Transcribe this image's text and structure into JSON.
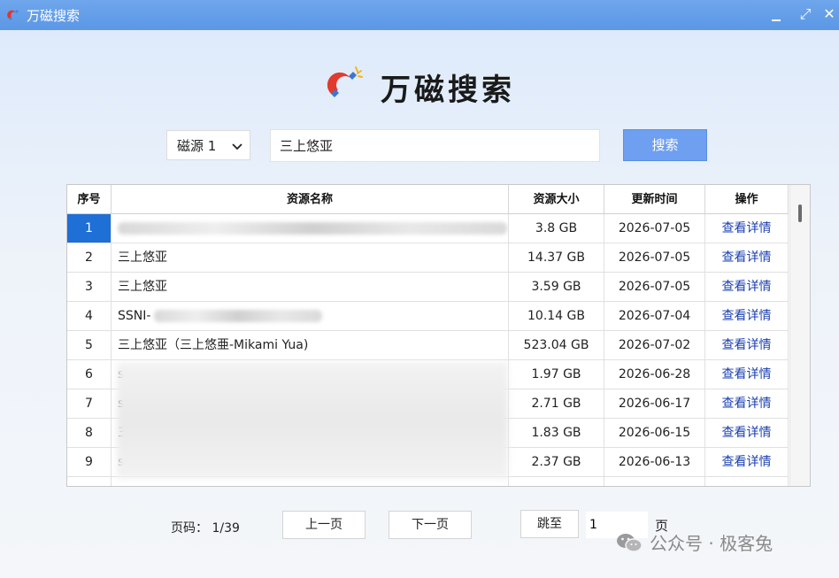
{
  "window": {
    "title": "万磁搜索",
    "minimize_icon": "minimize-icon",
    "maximize_glyph": "⤢",
    "close_glyph": "✕"
  },
  "brand": {
    "name": "万磁搜索",
    "logo_icon": "magnet-icon"
  },
  "search": {
    "source_selected": "磁源 1",
    "query": "三上悠亚",
    "button_label": "搜索"
  },
  "table": {
    "headers": {
      "index": "序号",
      "name": "资源名称",
      "size": "资源大小",
      "updated": "更新时间",
      "action": "操作"
    },
    "rows": [
      {
        "index": "1",
        "name": "",
        "size": "3.8 GB",
        "updated": "2026-07-05",
        "action": "查看详情"
      },
      {
        "index": "2",
        "name": "三上悠亚",
        "size": "14.37 GB",
        "updated": "2026-07-05",
        "action": "查看详情"
      },
      {
        "index": "3",
        "name": "三上悠亚",
        "size": "3.59 GB",
        "updated": "2026-07-05",
        "action": "查看详情"
      },
      {
        "index": "4",
        "name": "SSNI-",
        "size": "10.14 GB",
        "updated": "2026-07-04",
        "action": "查看详情"
      },
      {
        "index": "5",
        "name": "三上悠亚（三上悠亜-Mikami Yua)",
        "size": "523.04 GB",
        "updated": "2026-07-02",
        "action": "查看详情"
      },
      {
        "index": "6",
        "name": "s",
        "size": "1.97 GB",
        "updated": "2026-06-28",
        "action": "查看详情"
      },
      {
        "index": "7",
        "name": "s",
        "size": "2.71 GB",
        "updated": "2026-06-17",
        "action": "查看详情"
      },
      {
        "index": "8",
        "name": "三",
        "size": "1.83 GB",
        "updated": "2026-06-15",
        "action": "查看详情"
      },
      {
        "index": "9",
        "name": "s",
        "size": "2.37 GB",
        "updated": "2026-06-13",
        "action": "查看详情"
      }
    ]
  },
  "pagination": {
    "label": "页码：",
    "current": "1/39",
    "prev_label": "上一页",
    "next_label": "下一页",
    "jump_label": "跳至",
    "jump_value": "1",
    "unit": "页"
  },
  "watermark": {
    "text": "公众号 · 极客兔"
  },
  "colors": {
    "titlebar": "#5b97e6",
    "search_button": "#6f9ff0",
    "selected": "#1e6fd6",
    "link": "#1a3fb0"
  }
}
